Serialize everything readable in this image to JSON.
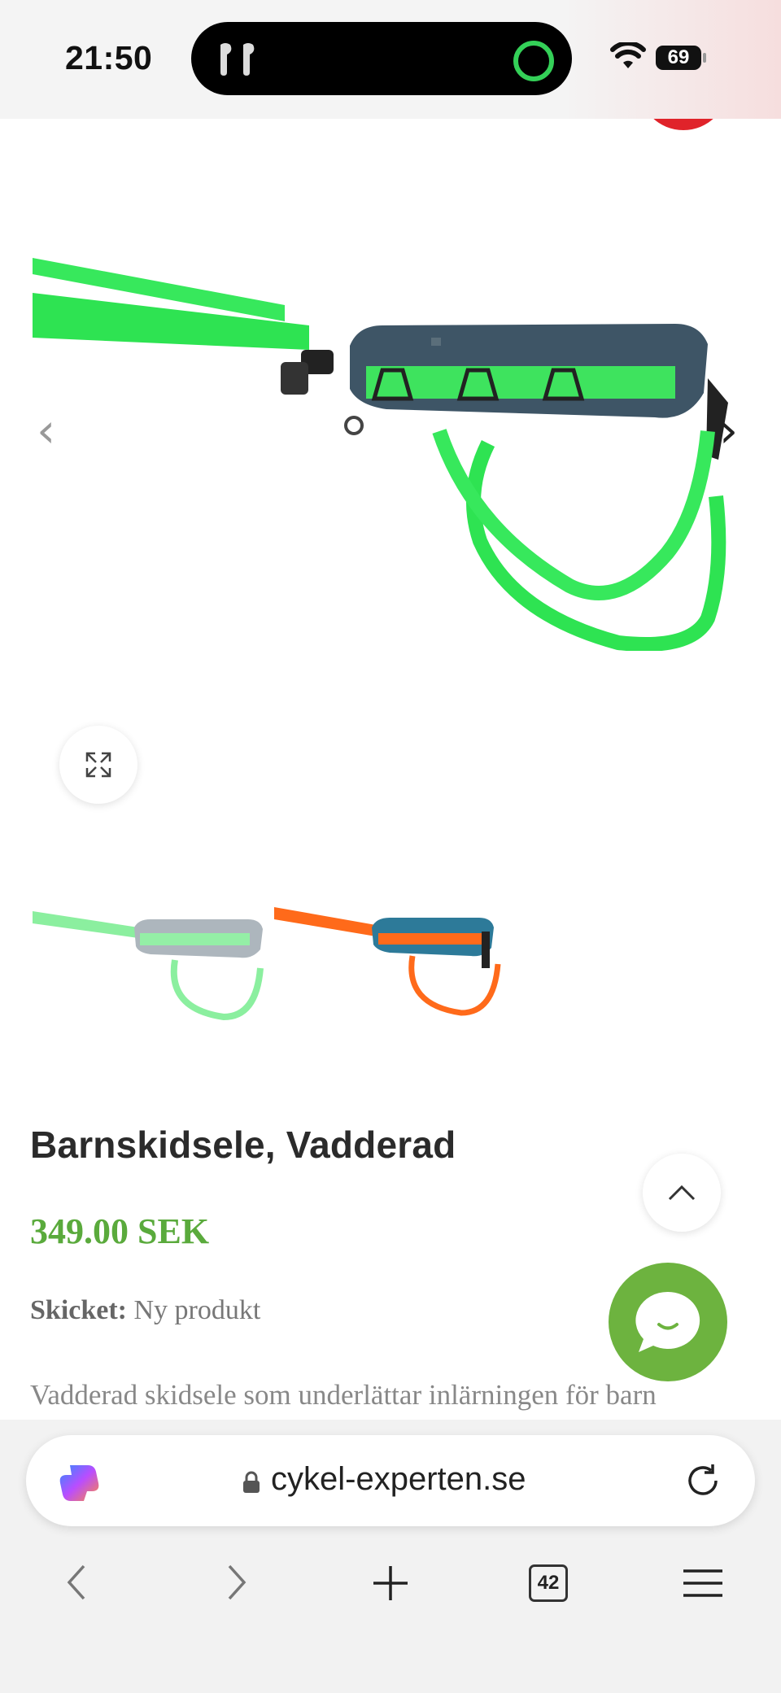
{
  "status_bar": {
    "time": "21:50",
    "battery": "69"
  },
  "product": {
    "title": "Barnskidsele, Vadderad",
    "price": "349.00 SEK",
    "condition_label": "Skicket:",
    "condition_value": "Ny produkt",
    "description": "Vadderad skidsele som underlättar inlärningen för barn"
  },
  "gallery": {
    "main_color": "green",
    "thumbnails": [
      {
        "color": "green",
        "selected": true
      },
      {
        "color": "orange",
        "selected": false
      }
    ]
  },
  "browser": {
    "url": "cykel-experten.se",
    "tab_count": "42"
  },
  "colors": {
    "price": "#5aaa3c",
    "chat": "#6db33f",
    "strap_green": "#2ee352",
    "strap_orange": "#ff6a1a",
    "belt_dark": "#3e5566",
    "belt_teal": "#2d7a99"
  }
}
